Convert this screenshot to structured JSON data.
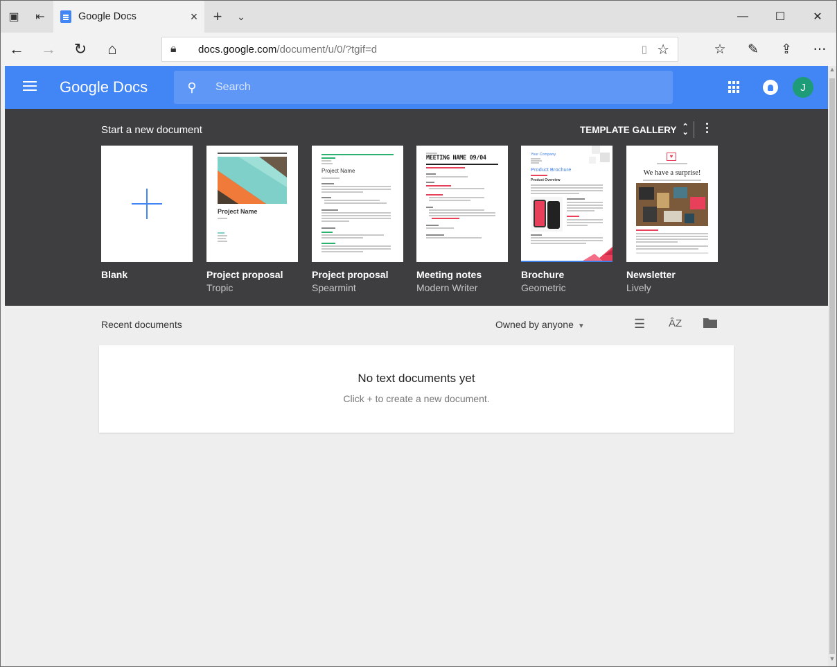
{
  "browser": {
    "tab_title": "Google Docs",
    "url_host": "docs.google.com",
    "url_path": "/document/u/0/?tgif=d",
    "controls": {
      "minimize": "—",
      "maximize": "☐",
      "close": "✕"
    }
  },
  "app": {
    "logo": "Google Docs",
    "search_placeholder": "Search",
    "avatar_initial": "J",
    "colors": {
      "header": "#4285f4",
      "template_bg": "#3e3e40",
      "avatar": "#1e9c78"
    }
  },
  "templates": {
    "heading": "Start a new document",
    "gallery_label": "TEMPLATE GALLERY",
    "items": [
      {
        "name": "Blank",
        "subtitle": ""
      },
      {
        "name": "Project proposal",
        "subtitle": "Tropic",
        "thumb_title": "Project Name"
      },
      {
        "name": "Project proposal",
        "subtitle": "Spearmint",
        "thumb_title": "Project Name"
      },
      {
        "name": "Meeting notes",
        "subtitle": "Modern Writer",
        "thumb_title": "MEETING NAME 09/04"
      },
      {
        "name": "Brochure",
        "subtitle": "Geometric",
        "thumb_title": "Product Brochure",
        "thumb_company": "Your Company",
        "thumb_section": "Product Overview"
      },
      {
        "name": "Newsletter",
        "subtitle": "Lively",
        "thumb_title": "We have a surprise!"
      }
    ]
  },
  "recent": {
    "heading": "Recent documents",
    "owner_filter": "Owned by anyone",
    "empty_title": "No text documents yet",
    "empty_hint": "Click + to create a new document."
  }
}
